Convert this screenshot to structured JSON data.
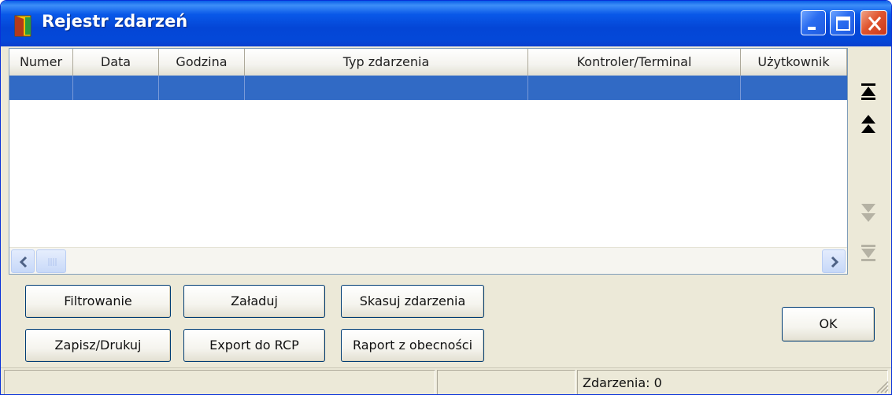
{
  "window": {
    "title": "Rejestr zdarzeń",
    "title_icon": "app-door-icon",
    "controls": [
      "minimize-icon",
      "maximize-icon",
      "close-icon"
    ]
  },
  "grid": {
    "columns": [
      "Numer",
      "Data",
      "Godzina",
      "Typ zdarzenia",
      "Kontroler/Terminal",
      "Użytkownik"
    ],
    "rows": [
      [
        "",
        "",
        "",
        "",
        "",
        ""
      ]
    ],
    "selected_row_color": "#316ac5"
  },
  "nav": {
    "icons": [
      "first-record-icon",
      "page-up-icon",
      "page-down-icon",
      "last-record-icon"
    ],
    "enabled": [
      true,
      true,
      false,
      false
    ]
  },
  "buttons": {
    "filter": "Filtrowanie",
    "load": "Załaduj",
    "delete_events": "Skasuj zdarzenia",
    "save_print": "Zapisz/Drukuj",
    "export_rcp": "Export do RCP",
    "attendance_report": "Raport z obecności",
    "ok": "OK"
  },
  "status": {
    "panel1": "",
    "panel2": "",
    "panel3": "Zdarzenia: 0"
  },
  "colors": {
    "titlebar": "#0446d6",
    "window_bg": "#ece9d8",
    "selection": "#316ac5",
    "close_button": "#e0552f"
  }
}
